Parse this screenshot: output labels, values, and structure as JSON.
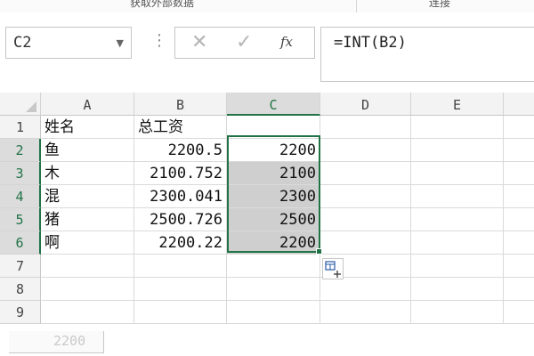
{
  "ribbon": {
    "group_get_data": "获取外部数据",
    "group_connections": "连接"
  },
  "formula_bar": {
    "name_box": "C2",
    "fx_label": "fx",
    "formula": "=INT(B2)"
  },
  "columns": [
    "A",
    "B",
    "C",
    "D",
    "E"
  ],
  "rows": [
    "1",
    "2",
    "3",
    "4",
    "5",
    "6",
    "7",
    "8",
    "9"
  ],
  "cells": {
    "A1": "姓名",
    "B1": "总工资",
    "A2": "鱼",
    "B2": "2200.5",
    "C2": "2200",
    "A3": "木",
    "B3": "2100.752",
    "C3": "2100",
    "A4": "混",
    "B4": "2300.041",
    "C4": "2300",
    "A5": "猪",
    "B5": "2500.726",
    "C5": "2500",
    "A6": "啊",
    "B6": "2200.22",
    "C6": "2200"
  },
  "status_strip": {
    "value": "2200"
  },
  "colors": {
    "accent": "#217346",
    "selection_fill": "#cfcfcf",
    "header_fill": "#f3f3f3"
  }
}
